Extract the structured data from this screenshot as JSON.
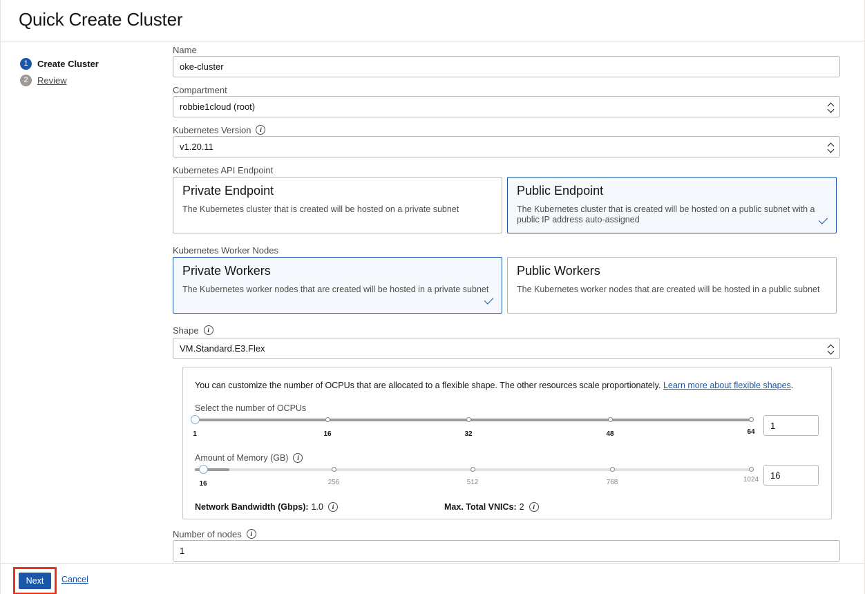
{
  "header": {
    "title": "Quick Create Cluster"
  },
  "steps": [
    {
      "num": "1",
      "label": "Create Cluster"
    },
    {
      "num": "2",
      "label": "Review"
    }
  ],
  "form": {
    "name": {
      "label": "Name",
      "value": "oke-cluster"
    },
    "compartment": {
      "label": "Compartment",
      "value": "robbie1cloud (root)"
    },
    "k8s_version": {
      "label": "Kubernetes Version",
      "value": "v1.20.11"
    },
    "api_endpoint": {
      "label": "Kubernetes API Endpoint",
      "options": [
        {
          "title": "Private Endpoint",
          "desc": "The Kubernetes cluster that is created will be hosted on a private subnet",
          "selected": false
        },
        {
          "title": "Public Endpoint",
          "desc": "The Kubernetes cluster that is created will be hosted on a public subnet with a public IP address auto-assigned",
          "selected": true
        }
      ]
    },
    "worker_nodes": {
      "label": "Kubernetes Worker Nodes",
      "options": [
        {
          "title": "Private Workers",
          "desc": "The Kubernetes worker nodes that are created will be hosted in a private subnet",
          "selected": true
        },
        {
          "title": "Public Workers",
          "desc": "The Kubernetes worker nodes that are created will be hosted in a public subnet",
          "selected": false
        }
      ]
    },
    "shape": {
      "label": "Shape",
      "value": "VM.Standard.E3.Flex"
    },
    "flex": {
      "note": "You can customize the number of OCPUs that are allocated to a flexible shape. The other resources scale proportionately.",
      "link": "Learn more about flexible shapes",
      "note_end": ".",
      "ocpu": {
        "label": "Select the number of OCPUs",
        "ticks": [
          "1",
          "16",
          "32",
          "48",
          "64"
        ],
        "value": "1"
      },
      "memory": {
        "label": "Amount of Memory (GB)",
        "ticks": [
          "16",
          "256",
          "512",
          "768",
          "1024"
        ],
        "value": "16"
      },
      "bandwidth": {
        "label": "Network Bandwidth (Gbps):",
        "value": "1.0"
      },
      "vnics": {
        "label": "Max. Total VNICs:",
        "value": "2"
      }
    },
    "nodes": {
      "label": "Number of nodes",
      "value": "1"
    }
  },
  "footer": {
    "next": "Next",
    "cancel": "Cancel"
  },
  "colors": {
    "accent": "#1a57a8",
    "highlight": "#e7331a"
  },
  "icons": {
    "info": "info-icon",
    "check": "check-icon",
    "select": "select-arrows-icon"
  }
}
